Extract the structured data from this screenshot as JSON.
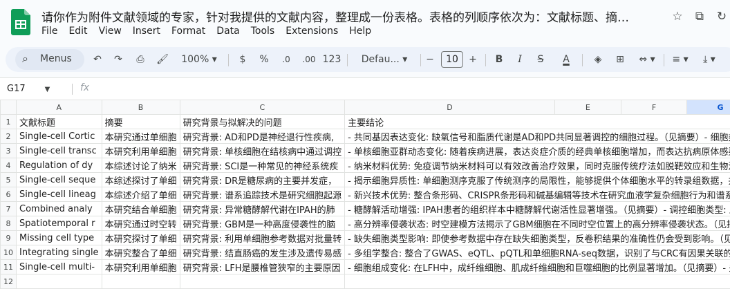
{
  "doc": {
    "title": "请你作为附件文献领域的专家，针对我提供的文献内容，整理成一份表格。表格的列顺序依次为：文献标题、摘…"
  },
  "menu": [
    "File",
    "Edit",
    "View",
    "Insert",
    "Format",
    "Data",
    "Tools",
    "Extensions",
    "Help"
  ],
  "toolbar": {
    "menus_label": "Menus",
    "zoom": "100%",
    "currency": "$",
    "percent": "%",
    "dec_less": ".0",
    "dec_more": ".00",
    "number_format": "123",
    "font": "Defau...",
    "font_size": "10",
    "bold": "B",
    "text_color": "A"
  },
  "formula": {
    "namebox": "G17",
    "fx": "fx",
    "value": ""
  },
  "columns": [
    "A",
    "B",
    "C",
    "D",
    "E",
    "F",
    "G"
  ],
  "selected_column": "G",
  "rows": [
    {
      "n": "1",
      "cells": [
        "文献标题",
        "摘要",
        "研究背景与拟解决的问题",
        "主要结论"
      ]
    },
    {
      "n": "2",
      "cells": [
        "Single-cell Cortic",
        "本研究通过单细胞",
        "研究背景: AD和PD是神经退行性疾病,",
        "- 共同基因表达变化: 缺氧信号和脂质代谢是AD和PD共同显著调控的细胞过程。（见摘要）- 细胞类型"
      ]
    },
    {
      "n": "3",
      "cells": [
        "Single-cell transc",
        "本研究利用单细胞",
        "研究背景: 单核细胞在结核病中通过调控",
        "- 单核细胞亚群动态变化: 随着疾病进展，表达炎症介质的经典单核细胞增加，而表达抗病原体感染"
      ]
    },
    {
      "n": "4",
      "cells": [
        "Regulation of dy",
        "本综述讨论了纳米",
        "研究背景: SCI是一种常见的神经系统疾",
        "- 纳米材料优势: 免疫调节纳米材料可以有效改善治疗效果，同时克服传统疗法如脱靶效应和生物活性"
      ]
    },
    {
      "n": "5",
      "cells": [
        "Single-cell seque",
        "本综述探讨了单细",
        "研究背景: DR是糖尿病的主要并发症，",
        "- 揭示细胞异质性: 单细胞测序克服了传统测序的局限性，能够提供个体细胞水平的转录组数据，并"
      ]
    },
    {
      "n": "6",
      "cells": [
        "Single-cell lineag",
        "本综述介绍了单细",
        "研究背景: 谱系追踪技术是研究细胞起源",
        "- 新兴技术优势: 整合条形码、CRISPR条形码和碱基编辑等技术在研究血液学复杂细胞行为和谱系动"
      ]
    },
    {
      "n": "7",
      "cells": [
        "Combined analy",
        "本研究结合单细胞",
        "研究背景: 异常糖酵解代谢在IPAH的肺",
        "- 糖酵解活动增强: IPAH患者的组织样本中糖酵解代谢活性显著增强。（见摘要）- 调控细胞类型: 血管"
      ]
    },
    {
      "n": "8",
      "cells": [
        "Spatiotemporal r",
        "本研究通过时空转",
        "研究背景: GBM是一种高度侵袭性的脑",
        "- 高分辨率侵袭状态: 时空建模方法揭示了GBM细胞在不同时空位置上的高分辨率侵袭状态。（见摘要"
      ]
    },
    {
      "n": "9",
      "cells": [
        "Missing cell type",
        "本研究探讨了单细",
        "研究背景: 利用单细胞参考数据对批量转",
        "- 缺失细胞类型影响: 即使参考数据中存在缺失细胞类型，反卷积结果的准确性仍会受到影响。（见摘"
      ]
    },
    {
      "n": "10",
      "cells": [
        "Integrating single",
        "本研究整合了单细",
        "研究背景: 结直肠癌的发生涉及遗传易感",
        "- 多组学整合: 整合了GWAS、eQTL、pQTL和单细胞RNA-seq数据，识别了与CRC有因果关联的基因"
      ]
    },
    {
      "n": "11",
      "cells": [
        "Single-cell multi-",
        "本研究利用单细胞",
        "研究背景: LFH是腰椎管狭窄的主要原因",
        "- 细胞组成变化: 在LFH中，成纤维细胞、肌成纤维细胞和巨噬细胞的比例显著增加。（见摘要）- 关键"
      ]
    },
    {
      "n": "12",
      "cells": [
        "",
        "",
        "",
        ""
      ]
    }
  ]
}
